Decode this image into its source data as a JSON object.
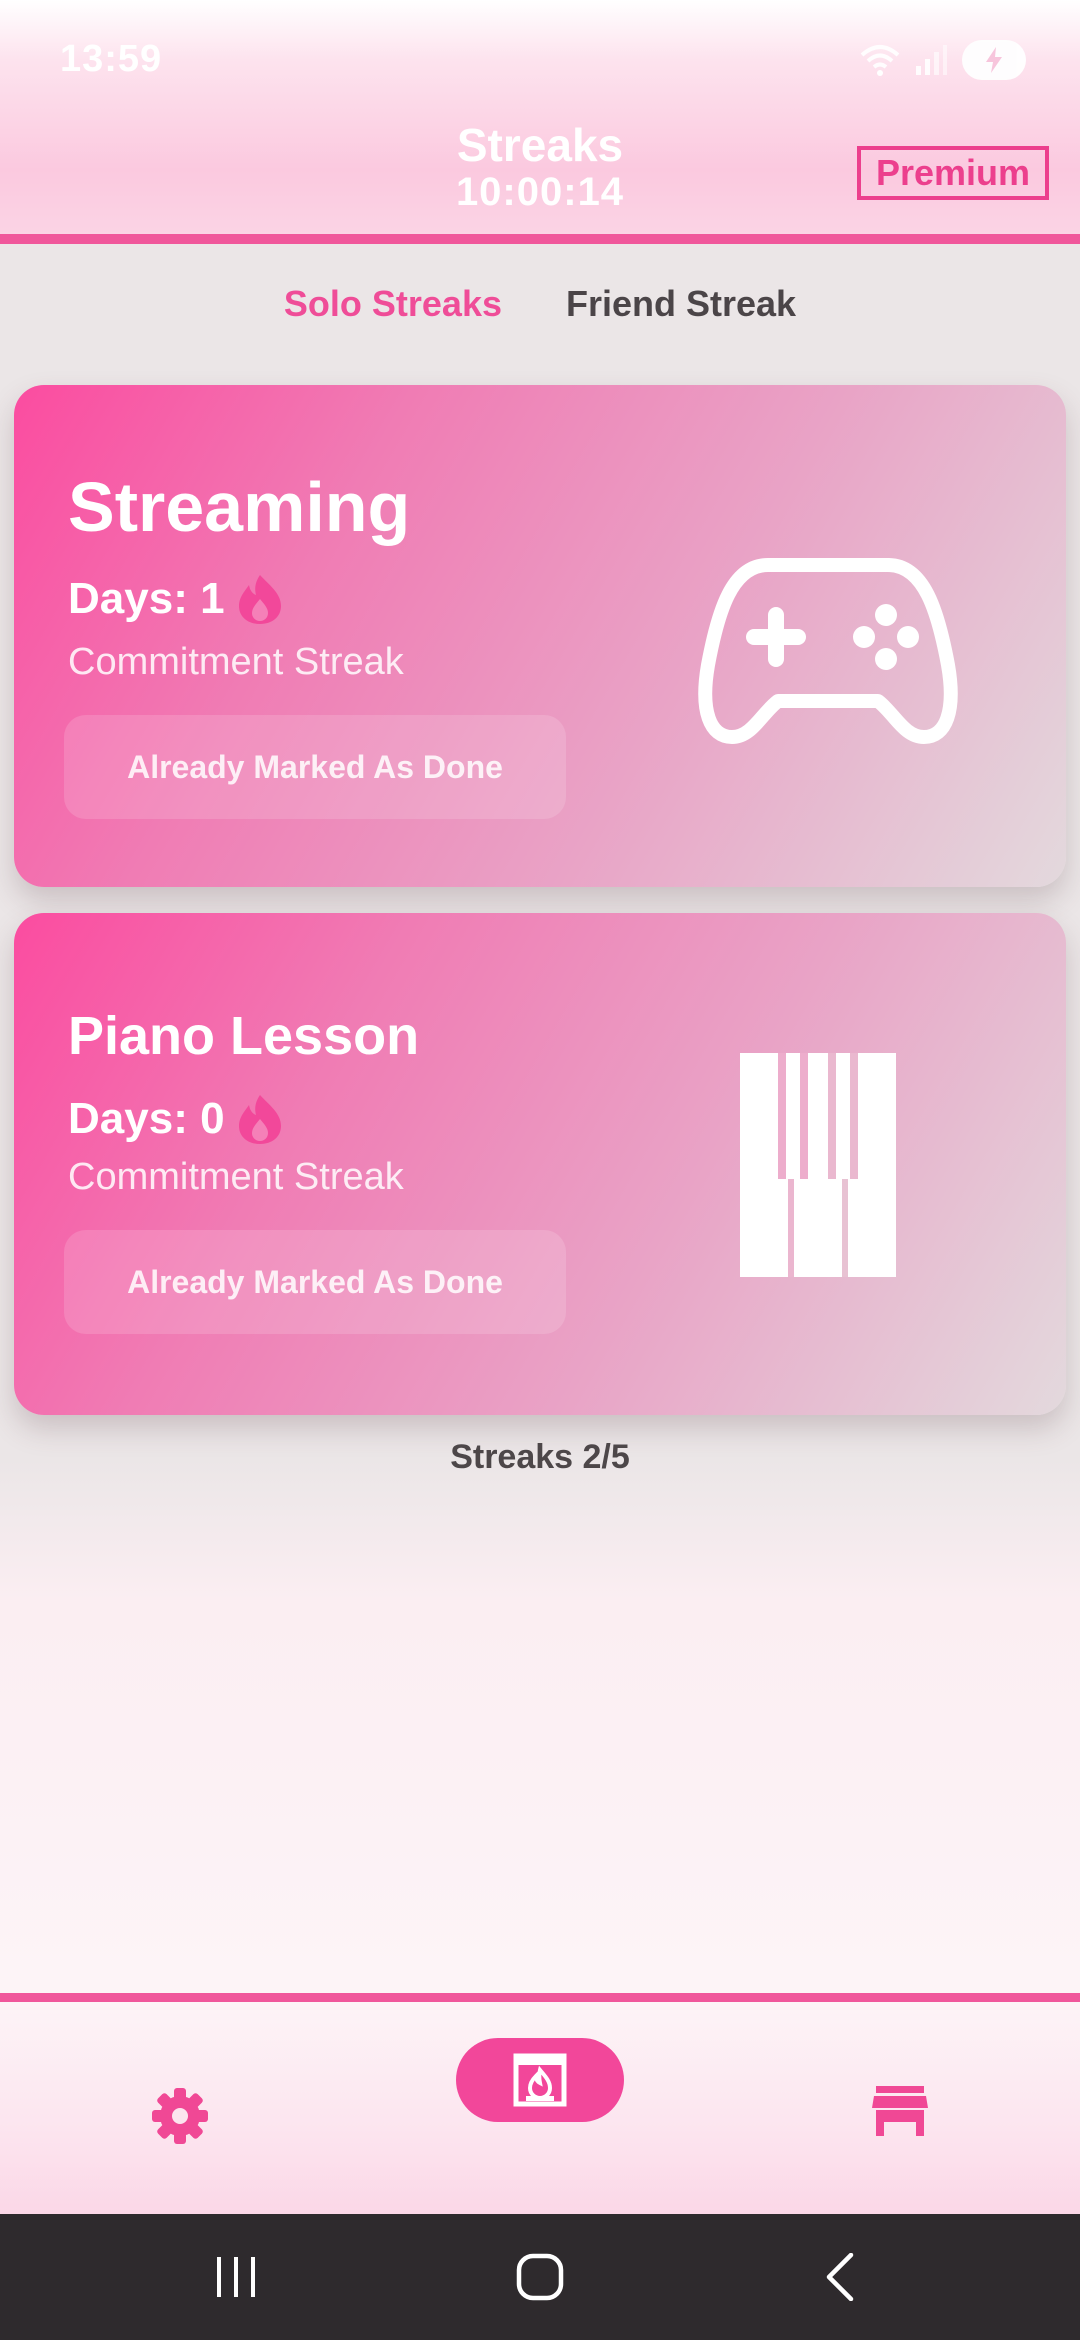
{
  "status_bar": {
    "time": "13:59"
  },
  "header": {
    "title": "Streaks",
    "timer": "10:00:14",
    "premium_label": "Premium"
  },
  "tabs": [
    {
      "label": "Solo Streaks",
      "active": true
    },
    {
      "label": "Friend Streak",
      "active": false
    }
  ],
  "cards": [
    {
      "name": "Streaming",
      "days_label": "Days: 1",
      "type_label": "Commitment Streak",
      "button_label": "Already Marked As Done",
      "icon": "gamepad-icon"
    },
    {
      "name": "Piano Lesson",
      "days_label": "Days: 0",
      "type_label": "Commitment Streak",
      "button_label": "Already Marked As Done",
      "icon": "piano-keys-icon"
    }
  ],
  "streak_count": "Streaks 2/5",
  "bottom_nav": [
    {
      "icon": "gear-icon"
    },
    {
      "icon": "fireplace-icon",
      "active": true
    },
    {
      "icon": "store-icon"
    }
  ],
  "colors": {
    "accent": "#f0579b",
    "card_gradient_start": "#fb4ca0",
    "card_gradient_end": "#e3d9dd",
    "system_nav": "#2e2a2d"
  }
}
